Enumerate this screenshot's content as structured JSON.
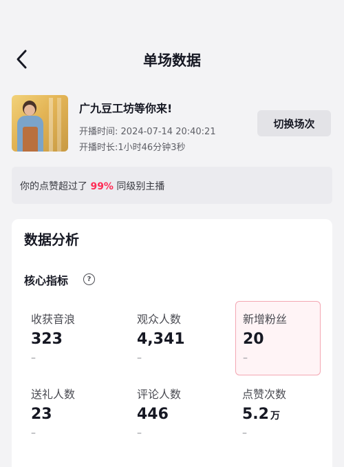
{
  "header": {
    "title": "单场数据"
  },
  "live": {
    "name": "广九豆工坊等你来!",
    "start_label": "开播时间:",
    "start_time": "2024-07-14 20:40:21",
    "duration_label": "开播时长:",
    "duration": "1小时46分钟3秒",
    "switch_label": "切换场次"
  },
  "likes": {
    "prefix": "你的点赞超过了",
    "percent": "99%",
    "suffix": "同级别主播"
  },
  "analysis": {
    "title": "数据分析",
    "core_title": "核心指标",
    "help": "?",
    "metrics": [
      {
        "label": "收获音浪",
        "value": "323",
        "unit": "",
        "trend": "–"
      },
      {
        "label": "观众人数",
        "value": "4,341",
        "unit": "",
        "trend": "–"
      },
      {
        "label": "新增粉丝",
        "value": "20",
        "unit": "",
        "trend": "–"
      },
      {
        "label": "送礼人数",
        "value": "23",
        "unit": "",
        "trend": "–"
      },
      {
        "label": "评论人数",
        "value": "446",
        "unit": "",
        "trend": "–"
      },
      {
        "label": "点赞次数",
        "value": "5.2",
        "unit": "万",
        "trend": "–"
      }
    ]
  },
  "colors": {
    "accent": "#fe2c55",
    "selected_border": "#f3a6b2"
  }
}
